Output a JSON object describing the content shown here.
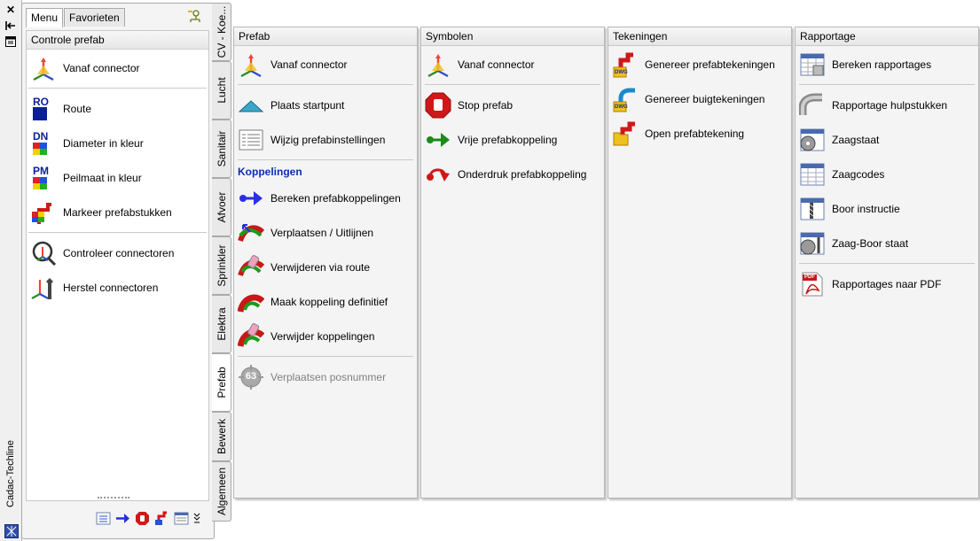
{
  "strip": {
    "title": "Cadac-Techline",
    "icons": [
      "close-icon",
      "collapse-icon",
      "properties-icon",
      "app-icon"
    ]
  },
  "palette": {
    "tabs": [
      "Menu",
      "Favorieten"
    ],
    "panel_title": "Controle prefab",
    "items_group1": [
      "Vanaf connector"
    ],
    "items_group2": [
      "Route",
      "Diameter in kleur",
      "Peilmaat in kleur",
      "Markeer prefabstukken"
    ],
    "items_group3": [
      "Controleer connectoren",
      "Herstel connectoren"
    ],
    "badges": {
      "route": "RO",
      "diameter": "DN",
      "peilmaat": "PM"
    }
  },
  "vertical_tabs": [
    "CV - Koe...",
    "Lucht",
    "Sanitair",
    "Afvoer",
    "Sprinkler",
    "Elektra",
    "Prefab",
    "Bewerk",
    "Algemeen"
  ],
  "active_vertical_tab": "Prefab",
  "flyout": {
    "prefab": {
      "title": "Prefab",
      "items_a": [
        "Vanaf connector"
      ],
      "items_b": [
        "Plaats startpunt",
        "Wijzig prefabinstellingen"
      ],
      "section": "Koppelingen",
      "items_c": [
        "Bereken prefabkoppelingen",
        "Verplaatsen / Uitlijnen",
        "Verwijderen via route",
        "Maak koppeling definitief",
        "Verwijder koppelingen"
      ],
      "items_d": [
        "Verplaatsen posnummer"
      ],
      "posnr_badge": "63"
    },
    "symbolen": {
      "title": "Symbolen",
      "items_a": [
        "Vanaf connector"
      ],
      "items_b": [
        "Stop prefab",
        "Vrije prefabkoppeling",
        "Onderdruk prefabkoppeling"
      ]
    },
    "tekeningen": {
      "title": "Tekeningen",
      "items": [
        "Genereer prefabtekeningen",
        "Genereer buigtekeningen",
        "Open prefabtekening"
      ],
      "dwg_badge": "DWG"
    },
    "rapportage": {
      "title": "Rapportage",
      "items_a": [
        "Bereken rapportages"
      ],
      "items_b": [
        "Rapportage hulpstukken",
        "Zaagstaat",
        "Zaagcodes",
        "Boor instructie",
        "Zaag-Boor staat"
      ],
      "items_c": [
        "Rapportages naar PDF"
      ],
      "pdf_badge": "PDF"
    }
  },
  "colors": {
    "section": "#0b2fb3",
    "panel_bg": "#f4f4f4",
    "border": "#b8b8b8"
  }
}
